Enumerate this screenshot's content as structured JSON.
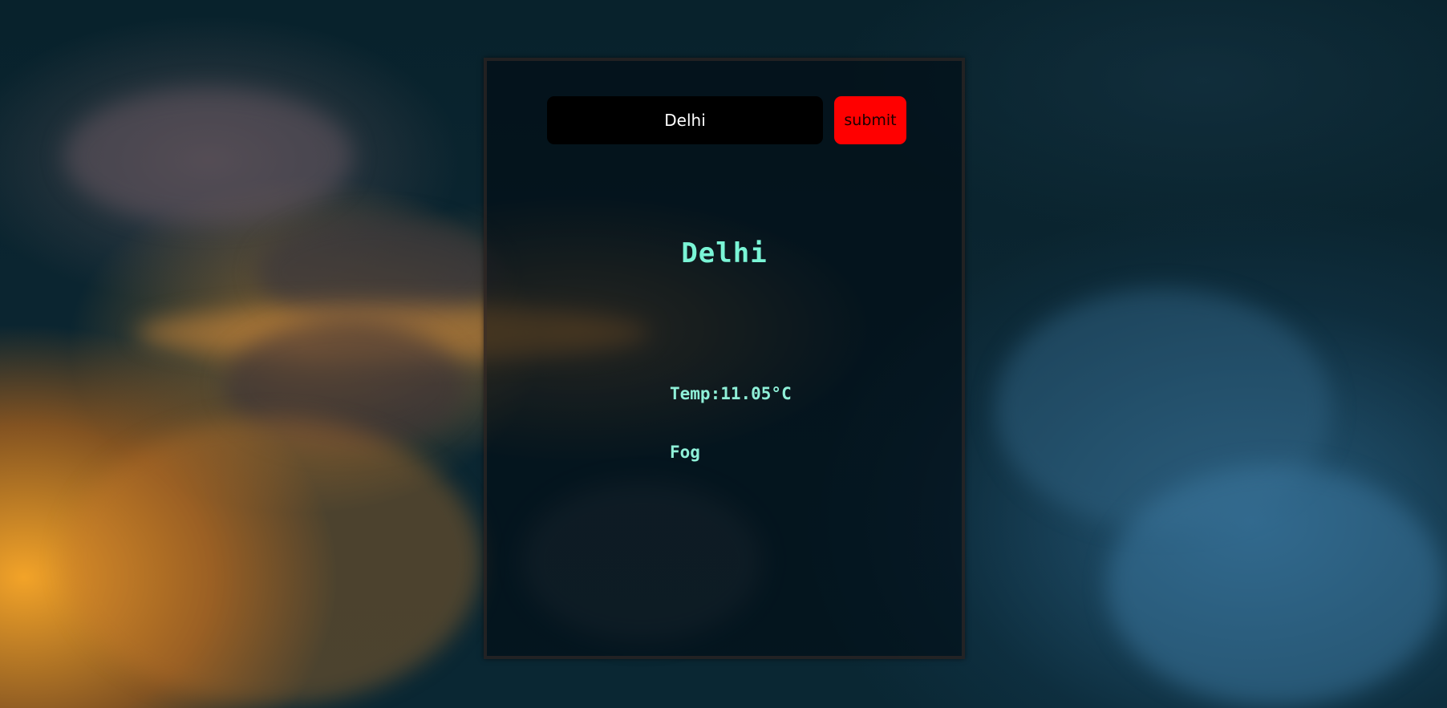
{
  "search": {
    "value": "Delhi",
    "button_label": "submit"
  },
  "weather": {
    "city": "Delhi",
    "temperature_text": "Temp:11.05°C",
    "condition": "Fog"
  },
  "colors": {
    "accent": "#7af5d6",
    "button": "#ff0000",
    "input_bg": "#000000"
  }
}
